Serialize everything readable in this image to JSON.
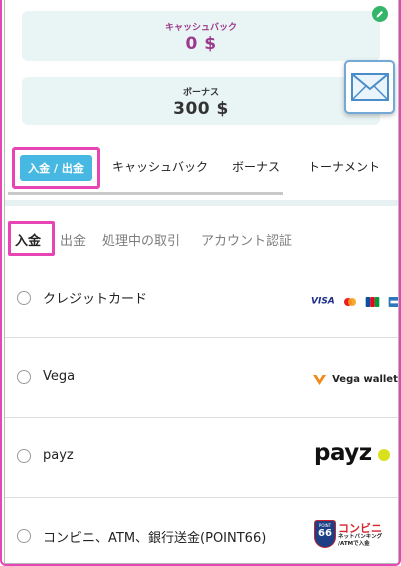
{
  "balances": {
    "cashback": {
      "label": "キャッシュバック",
      "amount": "0 $"
    },
    "bonus": {
      "label": "ボーナス",
      "amount": "300 $"
    }
  },
  "icons": {
    "edit": "pencil-icon",
    "mail": "envelope-icon"
  },
  "tabs": [
    {
      "label": "入金 / 出金",
      "active": true
    },
    {
      "label": "キャッシュバック"
    },
    {
      "label": "ボーナス"
    },
    {
      "label": "トーナメント"
    }
  ],
  "subtabs": [
    {
      "label": "入金",
      "active": true
    },
    {
      "label": "出金"
    },
    {
      "label": "処理中の取引"
    },
    {
      "label": "アカウント認証"
    }
  ],
  "payment_methods": [
    {
      "name": "クレジットカード",
      "logo_text": "VISA"
    },
    {
      "name": "Vega",
      "logo_text": "Vega wallet"
    },
    {
      "name": "payz",
      "logo_text": "payz"
    },
    {
      "name": "コンビニ、ATM、銀行送金(POINT66)",
      "logo_text": "コンビニ",
      "logo_subtext": "ネットバンキング /ATMで入金",
      "logo_badge": "66",
      "logo_badge_top": "POINT"
    }
  ],
  "colors": {
    "accent_pink": "#e745b3",
    "active_tab": "#46b8e2",
    "card_bg": "#e9f4f4",
    "cashback_text": "#9b3a8c",
    "edit_green": "#34b56a",
    "payz_yellow": "#d8e11b"
  }
}
